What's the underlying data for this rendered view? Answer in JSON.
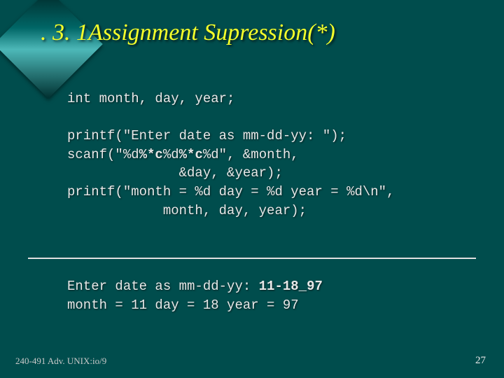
{
  "title": ". 3. 1Assignment Supression(*)",
  "code": {
    "l1": "int month, day, year;",
    "l2": "",
    "l3a": "printf(\"Enter date as mm-dd-yy: \");",
    "l4a": "scanf(\"%d",
    "l4b": "%*c",
    "l4c": "%d",
    "l4d": "%*c",
    "l4e": "%d\", &month,",
    "l5": "              &day, &year);",
    "l6": "printf(\"month = %d day = %d year = %d\\n\",",
    "l7": "            month, day, year);"
  },
  "output": {
    "o1a": "Enter date as mm-dd-yy: ",
    "o1b": "11-18_97",
    "o2": "month = 11 day = 18 year = 97"
  },
  "footer": {
    "left": "240-491 Adv. UNIX:io/9",
    "right": "27"
  }
}
